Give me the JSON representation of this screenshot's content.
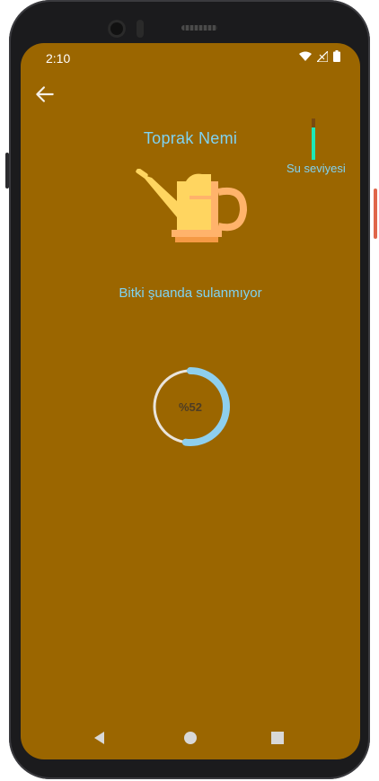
{
  "status_bar": {
    "time": "2:10"
  },
  "header": {
    "title": "Toprak Nemi"
  },
  "water_level": {
    "label": "Su seviyesi",
    "fill_fraction": 0.78
  },
  "plant_status": {
    "text": "Bitki şuanda sulanmıyor"
  },
  "moisture": {
    "percent_label": "%52",
    "percent": 52
  },
  "colors": {
    "background": "#9b6600",
    "accent_text": "#7fd3f2",
    "progress_ring": "#8ecfee",
    "progress_track": "#e9e4dc",
    "water_level": "#1de9b6"
  },
  "icons": {
    "back": "arrow-left-icon",
    "watering_can": "watering-can-icon",
    "wifi": "wifi-icon",
    "signal": "signal-icon",
    "battery": "battery-icon"
  }
}
